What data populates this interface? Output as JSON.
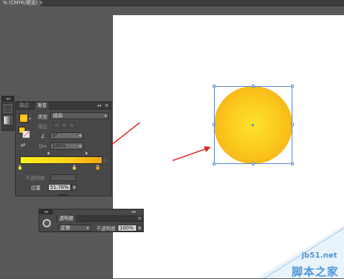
{
  "document_tab": {
    "title": "% (CMYK/预览)",
    "close_glyph": "×"
  },
  "watermark": {
    "site": "jb51.net",
    "name": "脚本之家"
  },
  "side_strip": {
    "grip": "◂◂"
  },
  "gradient_panel": {
    "tabs": [
      {
        "label": "描边"
      },
      {
        "label": "渐变"
      }
    ],
    "collapse_glyph": "◂◂",
    "menu_glyph": "≡",
    "type_label": "类型",
    "type_value": "径向",
    "stroke_label": "描边",
    "angle_value": "0°",
    "aspect_value": "100%",
    "opacity_label": "不透明度",
    "location_label": "位置",
    "location_value": "51.76%",
    "caret_glyph": "▾",
    "stops": [
      {
        "color": "#fdf21e"
      },
      {
        "color": "#fbd01c"
      },
      {
        "color": "#f4a314"
      }
    ]
  },
  "transparency_panel": {
    "grip": "◂◂",
    "title": "透明度",
    "collapse_glyph": "◂◂",
    "menu_glyph": "≡",
    "blend_mode": "正常",
    "opacity_label": "不透明度",
    "opacity_value": "100%",
    "caret_glyph": "▾"
  },
  "colors": {
    "gradient_center": "#fde22b",
    "gradient_edge": "#f5a414",
    "selection": "#4a7fd6",
    "annotation_arrow": "#e02020",
    "watermark": "#4e96d8"
  }
}
